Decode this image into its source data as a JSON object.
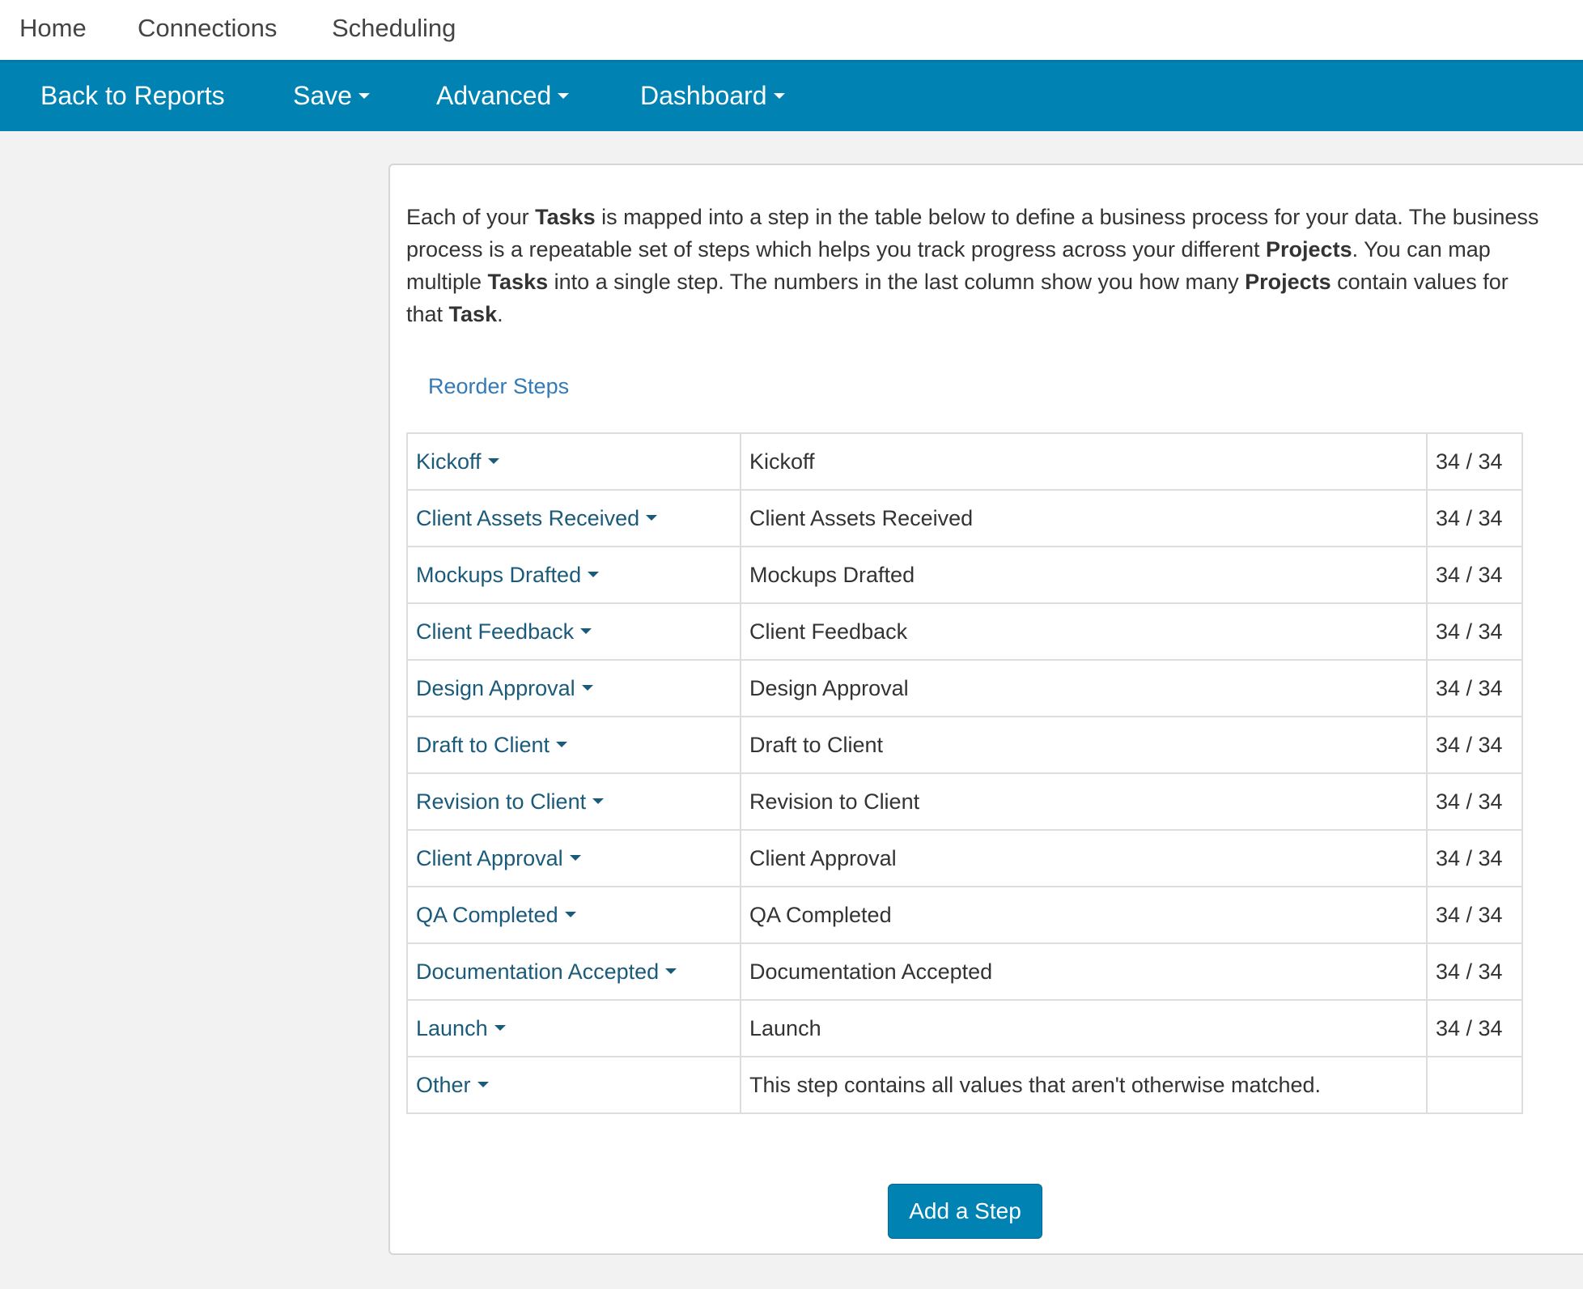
{
  "top_nav": {
    "items": [
      "Home",
      "Connections",
      "Scheduling"
    ]
  },
  "toolbar": {
    "back_label": "Back to Reports",
    "save_label": "Save",
    "advanced_label": "Advanced",
    "dashboard_label": "Dashboard",
    "color": "#0083b3"
  },
  "intro": {
    "t1": "Each of your ",
    "b1": "Tasks",
    "t2": " is mapped into a step in the table below to define a business process for your data. The business process is a repeatable set of steps which helps you track progress across your different ",
    "b2": "Projects",
    "t3": ". You can map multiple ",
    "b3": "Tasks",
    "t4": " into a single step. The numbers in the last column show you how many ",
    "b4": "Projects",
    "t5": " contain values for that ",
    "b5": "Task",
    "t6": "."
  },
  "reorder_label": "Reorder Steps",
  "steps": [
    {
      "step": "Kickoff",
      "task": "Kickoff",
      "count": "34 / 34"
    },
    {
      "step": "Client Assets Received",
      "task": "Client Assets Received",
      "count": "34 / 34"
    },
    {
      "step": "Mockups Drafted",
      "task": "Mockups Drafted",
      "count": "34 / 34"
    },
    {
      "step": "Client Feedback",
      "task": "Client Feedback",
      "count": "34 / 34"
    },
    {
      "step": "Design Approval",
      "task": "Design Approval",
      "count": "34 / 34"
    },
    {
      "step": "Draft to Client",
      "task": "Draft to Client",
      "count": "34 / 34"
    },
    {
      "step": "Revision to Client",
      "task": "Revision to Client",
      "count": "34 / 34"
    },
    {
      "step": "Client Approval",
      "task": "Client Approval",
      "count": "34 / 34"
    },
    {
      "step": "QA Completed",
      "task": "QA Completed",
      "count": "34 / 34"
    },
    {
      "step": "Documentation Accepted",
      "task": "Documentation Accepted",
      "count": "34 / 34"
    },
    {
      "step": "Launch",
      "task": "Launch",
      "count": "34 / 34"
    },
    {
      "step": "Other",
      "task": "This step contains all values that aren't otherwise matched.",
      "count": ""
    }
  ],
  "add_step_label": "Add a Step"
}
